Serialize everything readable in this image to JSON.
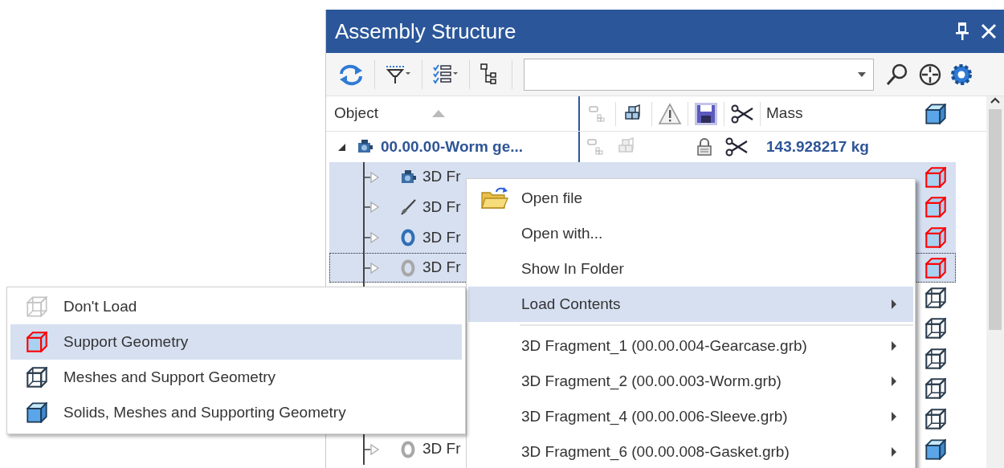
{
  "panel": {
    "title": "Assembly Structure"
  },
  "columns": {
    "object": "Object",
    "sort_ascending": true,
    "mass": "Mass"
  },
  "tree": {
    "root": {
      "label": "00.00.00-Worm ge...",
      "mass": "143.928217 kg",
      "expanded": true,
      "children": [
        {
          "part": {
            "kind": "housing"
          },
          "label": "3D Fr",
          "load": {
            "kind": "support"
          },
          "selected": true,
          "focused": false,
          "expanded": false
        },
        {
          "part": {
            "kind": "shaft"
          },
          "label": "3D Fr",
          "load": {
            "kind": "support"
          },
          "selected": true,
          "focused": false,
          "expanded": false
        },
        {
          "part": {
            "kind": "ring"
          },
          "label": "3D Fr",
          "load": {
            "kind": "support"
          },
          "selected": true,
          "focused": false,
          "expanded": false
        },
        {
          "part": {
            "kind": "washer"
          },
          "label": "3D Fr",
          "load": {
            "kind": "support"
          },
          "selected": true,
          "focused": true,
          "expanded": false
        },
        {
          "load": {
            "kind": "meshes"
          }
        },
        {
          "load": {
            "kind": "meshes"
          }
        },
        {
          "load": {
            "kind": "meshes"
          }
        },
        {
          "load": {
            "kind": "meshes"
          }
        },
        {
          "load": {
            "kind": "meshes"
          }
        },
        {
          "part": {
            "kind": "washer"
          },
          "label": "3D Fr",
          "load": {
            "kind": "solids"
          },
          "selected": false,
          "focused": false,
          "expanded": false
        }
      ]
    }
  },
  "context_menu": {
    "groups": [
      [
        {
          "kind": "icon-command",
          "label": "Open file",
          "selected": false
        },
        {
          "kind": "command",
          "label": "Open with...",
          "selected": false
        },
        {
          "kind": "command",
          "label": "Show In Folder",
          "selected": false
        },
        {
          "kind": "submenu",
          "label": "Load Contents",
          "selected": true
        }
      ],
      [
        {
          "kind": "submenu",
          "label": "3D Fragment_1 (00.00.004-Gearcase.grb)",
          "selected": false
        },
        {
          "kind": "submenu",
          "label": "3D Fragment_2 (00.00.003-Worm.grb)",
          "selected": false
        },
        {
          "kind": "submenu",
          "label": "3D Fragment_4 (00.00.006-Sleeve.grb)",
          "selected": false
        },
        {
          "kind": "submenu",
          "label": "3D Fragment_6 (00.00.008-Gasket.grb)",
          "selected": false
        }
      ]
    ]
  },
  "submenu": {
    "items": [
      {
        "label": "Don't Load",
        "load": {
          "kind": "none"
        },
        "selected": false
      },
      {
        "label": "Support Geometry",
        "load": {
          "kind": "support"
        },
        "selected": true
      },
      {
        "label": "Meshes and Support Geometry",
        "load": {
          "kind": "meshes"
        },
        "selected": false
      },
      {
        "label": "Solids, Meshes and Supporting Geometry",
        "load": {
          "kind": "solids"
        },
        "selected": false
      }
    ]
  }
}
